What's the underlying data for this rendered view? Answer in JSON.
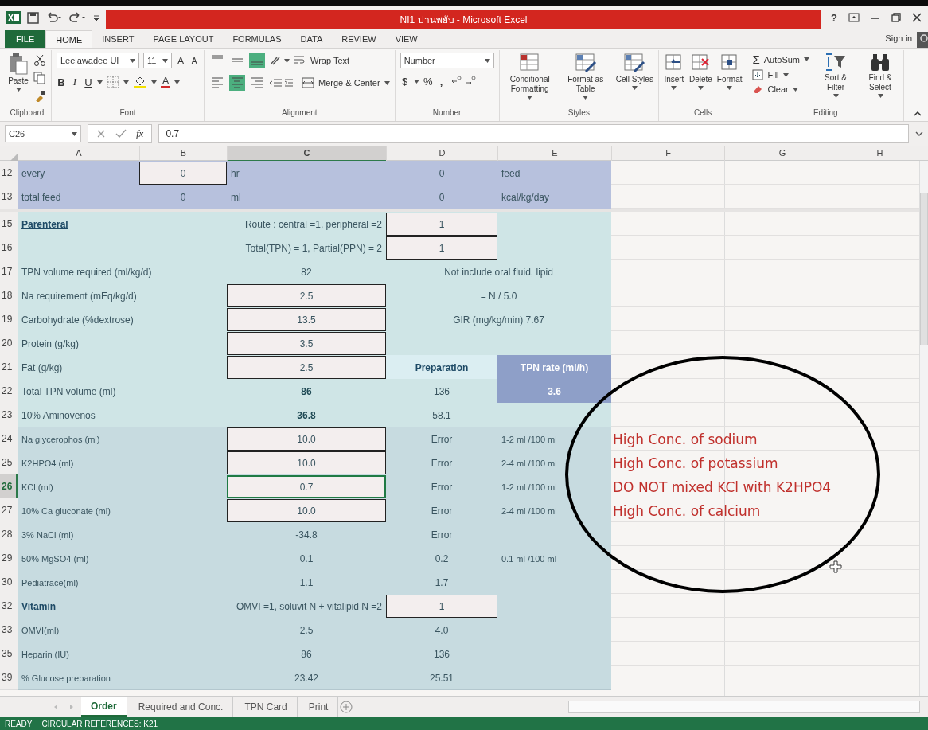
{
  "window": {
    "title": "NI1 ปานพยับ - Microsoft Excel",
    "help": "?"
  },
  "ribbon_tabs": [
    {
      "label": "FILE",
      "kind": "file",
      "selected": false
    },
    {
      "label": "HOME",
      "kind": "tab",
      "selected": true
    },
    {
      "label": "INSERT",
      "kind": "tab",
      "selected": false
    },
    {
      "label": "PAGE LAYOUT",
      "kind": "tab",
      "selected": false
    },
    {
      "label": "FORMULAS",
      "kind": "tab",
      "selected": false
    },
    {
      "label": "DATA",
      "kind": "tab",
      "selected": false
    },
    {
      "label": "REVIEW",
      "kind": "tab",
      "selected": false
    },
    {
      "label": "VIEW",
      "kind": "tab",
      "selected": false
    }
  ],
  "sign_in": "Sign in",
  "ribbon": {
    "clipboard": {
      "paste": "Paste",
      "label": "Clipboard"
    },
    "font": {
      "name": "Leelawadee UI",
      "size": "11",
      "grow": "A",
      "shrink": "A",
      "bold": "B",
      "italic": "I",
      "underline": "U",
      "color_letter": "A",
      "label": "Font"
    },
    "alignment": {
      "vertical": [
        {
          "selected": false
        },
        {
          "selected": false
        },
        {
          "selected": true
        }
      ],
      "horizontal": [
        {
          "selected": false
        },
        {
          "selected": true
        },
        {
          "selected": false
        }
      ],
      "wrap": "Wrap Text",
      "merge": "Merge & Center",
      "label": "Alignment"
    },
    "number": {
      "format": "Number",
      "currency": "$",
      "percent": "%",
      "comma": ",",
      "label": "Number"
    },
    "styles": {
      "buttons": [
        "Conditional Formatting",
        "Format as Table",
        "Cell Styles"
      ],
      "label": "Styles"
    },
    "cells": {
      "buttons": [
        "Insert",
        "Delete",
        "Format"
      ],
      "label": "Cells"
    },
    "editing": {
      "sigma": "Σ",
      "autosum": "AutoSum",
      "fill": "Fill",
      "clear": "Clear",
      "sort": "Sort & Filter",
      "find": "Find & Select",
      "label": "Editing"
    }
  },
  "formula_bar": {
    "name_box": "C26",
    "function_label": "fx",
    "value": "0.7"
  },
  "columns": [
    {
      "label": "A",
      "selected": false
    },
    {
      "label": "B",
      "selected": false
    },
    {
      "label": "C",
      "selected": true
    },
    {
      "label": "D",
      "selected": false
    },
    {
      "label": "E",
      "selected": false
    },
    {
      "label": "F",
      "selected": false
    },
    {
      "label": "G",
      "selected": false
    },
    {
      "label": "H",
      "selected": false
    }
  ],
  "rows": [
    {
      "num": "12",
      "kind": "purple",
      "selected": false,
      "cells": {
        "A": {
          "kind": "label",
          "text": "every"
        },
        "B": {
          "kind": "input",
          "text": "0"
        },
        "C": {
          "kind": "label",
          "text": "hr"
        },
        "D": {
          "kind": "value",
          "text": "0"
        },
        "E": {
          "kind": "label",
          "text": "feed"
        }
      }
    },
    {
      "num": "13",
      "kind": "purple",
      "selected": false,
      "cells": {
        "A": {
          "kind": "label",
          "text": "total feed"
        },
        "B": {
          "kind": "value",
          "text": "0"
        },
        "C": {
          "kind": "label",
          "text": "ml"
        },
        "D": {
          "kind": "value",
          "text": "0"
        },
        "E": {
          "kind": "label",
          "text": "kcal/kg/day"
        }
      }
    },
    {
      "num": "15",
      "kind": "teal",
      "selected": false,
      "cells": {
        "A": {
          "kind": "heading",
          "text": "Parenteral"
        },
        "C": {
          "kind": "note-right",
          "text": "Route : central =1, peripheral =2"
        },
        "D": {
          "kind": "input",
          "text": "1"
        }
      }
    },
    {
      "num": "16",
      "kind": "teal",
      "selected": false,
      "cells": {
        "C": {
          "kind": "note-right",
          "text": "Total(TPN) = 1, Partial(PPN) = 2"
        },
        "D": {
          "kind": "input",
          "text": "1"
        }
      }
    },
    {
      "num": "17",
      "kind": "teal",
      "selected": false,
      "cells": {
        "A": {
          "kind": "label",
          "text": "TPN volume required (ml/kg/d)"
        },
        "C": {
          "kind": "value",
          "text": "82"
        },
        "D": {
          "kind": "note",
          "text": "Not include oral fluid, lipid"
        }
      }
    },
    {
      "num": "18",
      "kind": "teal",
      "selected": false,
      "cells": {
        "A": {
          "kind": "label",
          "text": "Na requirement (mEq/kg/d)"
        },
        "C": {
          "kind": "input",
          "text": "2.5"
        },
        "D": {
          "kind": "note",
          "text": "=  N / 5.0"
        }
      }
    },
    {
      "num": "19",
      "kind": "teal",
      "selected": false,
      "cells": {
        "A": {
          "kind": "label",
          "text": "Carbohydrate (%dextrose)"
        },
        "C": {
          "kind": "input",
          "text": "13.5"
        },
        "D": {
          "kind": "note",
          "text": "GIR (mg/kg/min) 7.67"
        }
      }
    },
    {
      "num": "20",
      "kind": "teal",
      "selected": false,
      "cells": {
        "A": {
          "kind": "label",
          "text": "Protein (g/kg)"
        },
        "C": {
          "kind": "input",
          "text": "3.5"
        }
      }
    },
    {
      "num": "21",
      "kind": "teal",
      "selected": false,
      "cells": {
        "A": {
          "kind": "label",
          "text": "Fat (g/kg)"
        },
        "C": {
          "kind": "input",
          "text": "2.5"
        },
        "D": {
          "kind": "header",
          "text": "Preparation"
        },
        "E": {
          "kind": "rate-header",
          "text": "TPN rate (ml/h)"
        }
      }
    },
    {
      "num": "22",
      "kind": "teal",
      "selected": false,
      "cells": {
        "A": {
          "kind": "label",
          "text": "Total TPN volume (ml)"
        },
        "C": {
          "kind": "bold",
          "text": "86"
        },
        "D": {
          "kind": "value",
          "text": "136"
        },
        "E": {
          "kind": "rate",
          "text": "3.6"
        }
      }
    },
    {
      "num": "23",
      "kind": "teal",
      "selected": false,
      "cells": {
        "A": {
          "kind": "label",
          "text": "10% Aminovenos"
        },
        "C": {
          "kind": "bold",
          "text": "36.8"
        },
        "D": {
          "kind": "value",
          "text": "58.1"
        }
      }
    },
    {
      "num": "24",
      "kind": "grey",
      "selected": false,
      "cells": {
        "A": {
          "kind": "label",
          "text": "Na glycerophos (ml)"
        },
        "C": {
          "kind": "input",
          "text": "10.0"
        },
        "D": {
          "kind": "value",
          "text": "Error"
        },
        "E": {
          "kind": "label",
          "text": "1-2 ml /100 ml"
        },
        "F": {
          "kind": "alert",
          "text": "High Conc. of sodium"
        }
      }
    },
    {
      "num": "25",
      "kind": "grey",
      "selected": false,
      "cells": {
        "A": {
          "kind": "label",
          "text": "K2HPO4 (ml)"
        },
        "C": {
          "kind": "input",
          "text": "10.0"
        },
        "D": {
          "kind": "value",
          "text": "Error"
        },
        "E": {
          "kind": "label",
          "text": "2-4 ml /100 ml"
        },
        "F": {
          "kind": "alert",
          "text": "High Conc. of potassium"
        }
      }
    },
    {
      "num": "26",
      "kind": "grey",
      "selected": true,
      "cells": {
        "A": {
          "kind": "label",
          "text": "KCl (ml)"
        },
        "C": {
          "kind": "input",
          "text": "0.7"
        },
        "D": {
          "kind": "value",
          "text": "Error"
        },
        "E": {
          "kind": "label",
          "text": "1-2 ml /100 ml"
        },
        "F": {
          "kind": "alert",
          "text": "DO NOT mixed KCl with K2HPO4"
        }
      }
    },
    {
      "num": "27",
      "kind": "grey",
      "selected": false,
      "cells": {
        "A": {
          "kind": "label",
          "text": "10% Ca gluconate (ml)"
        },
        "C": {
          "kind": "input",
          "text": "10.0"
        },
        "D": {
          "kind": "value",
          "text": "Error"
        },
        "E": {
          "kind": "label",
          "text": "2-4 ml /100 ml"
        },
        "F": {
          "kind": "alert",
          "text": "High Conc. of calcium"
        }
      }
    },
    {
      "num": "28",
      "kind": "grey",
      "selected": false,
      "cells": {
        "A": {
          "kind": "label",
          "text": "3% NaCl  (ml)"
        },
        "C": {
          "kind": "value",
          "text": "-34.8"
        },
        "D": {
          "kind": "value",
          "text": "Error"
        }
      }
    },
    {
      "num": "29",
      "kind": "grey",
      "selected": false,
      "cells": {
        "A": {
          "kind": "label",
          "text": "50% MgSO4 (ml)"
        },
        "C": {
          "kind": "value",
          "text": "0.1"
        },
        "D": {
          "kind": "value",
          "text": "0.2"
        },
        "E": {
          "kind": "label",
          "text": "0.1 ml /100 ml"
        }
      }
    },
    {
      "num": "30",
      "kind": "grey",
      "selected": false,
      "cells": {
        "A": {
          "kind": "label",
          "text": "Pediatrace(ml)"
        },
        "C": {
          "kind": "value",
          "text": "1.1"
        },
        "D": {
          "kind": "value",
          "text": "1.7"
        }
      }
    },
    {
      "num": "32",
      "kind": "grey",
      "selected": false,
      "cells": {
        "A": {
          "kind": "heading-plain",
          "text": "Vitamin"
        },
        "B": {
          "kind": "note-right",
          "text": "OMVI =1, soluvit N + vitalipid N =2"
        },
        "D": {
          "kind": "input",
          "text": "1"
        }
      }
    },
    {
      "num": "33",
      "kind": "grey",
      "selected": false,
      "cells": {
        "A": {
          "kind": "label",
          "text": "OMVI(ml)"
        },
        "C": {
          "kind": "value",
          "text": "2.5"
        },
        "D": {
          "kind": "value",
          "text": "4.0"
        }
      }
    },
    {
      "num": "35",
      "kind": "grey",
      "selected": false,
      "cells": {
        "A": {
          "kind": "label",
          "text": "Heparin (IU)"
        },
        "C": {
          "kind": "value",
          "text": "86"
        },
        "D": {
          "kind": "value",
          "text": "136"
        }
      }
    },
    {
      "num": "39",
      "kind": "grey",
      "selected": false,
      "cells": {
        "A": {
          "kind": "label",
          "text": "% Glucose preparation"
        },
        "C": {
          "kind": "value",
          "text": "23.42"
        },
        "D": {
          "kind": "value",
          "text": "25.51"
        }
      }
    }
  ],
  "sheet_tabs": [
    {
      "label": "Order",
      "selected": true
    },
    {
      "label": "Required and Conc.",
      "selected": false
    },
    {
      "label": "TPN Card",
      "selected": false
    },
    {
      "label": "Print",
      "selected": false
    }
  ],
  "status_bar": {
    "mode": "READY",
    "message": "CIRCULAR REFERENCES: K21"
  }
}
